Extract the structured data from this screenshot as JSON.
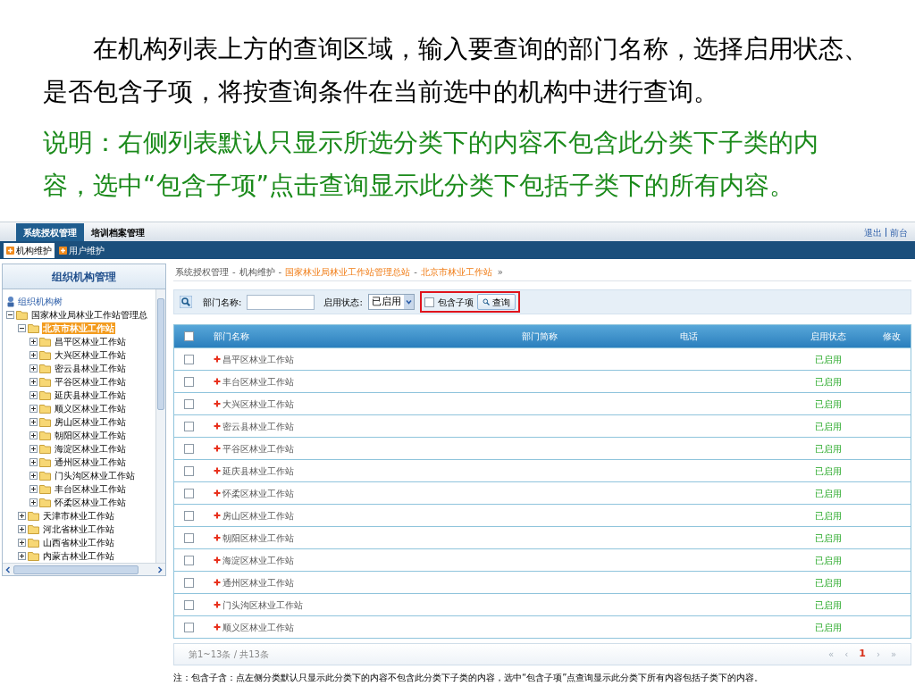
{
  "slide": {
    "paragraph": "在机构列表上方的查询区域，输入要查询的部门名称，选择启用状态、是否包含子项，将按查询条件在当前选中的机构中进行查询。",
    "note": "说明：右侧列表默认只显示所选分类下的内容不包含此分类下子类的内容，选中“包含子项”点击查询显示此分类下包括子类下的所有内容。"
  },
  "top_tabs": [
    {
      "label": "系统授权管理",
      "selected": true
    },
    {
      "label": "培训档案管理",
      "selected": false
    }
  ],
  "top_links": [
    "退出",
    "前台"
  ],
  "sub_tabs": [
    {
      "label": "机构维护",
      "selected": true
    },
    {
      "label": "用户维护",
      "selected": false
    }
  ],
  "sidebar": {
    "title": "组织机构管理",
    "tree": [
      {
        "label": "组织机构树",
        "kind": "root",
        "selected": false,
        "children": [
          {
            "label": "国家林业局林业工作站管理总",
            "kind": "folder",
            "selected": false,
            "expanded": true,
            "children": [
              {
                "label": "北京市林业工作站",
                "kind": "folder",
                "selected": true,
                "expanded": true,
                "children": [
                  {
                    "label": "昌平区林业工作站",
                    "kind": "folder",
                    "selected": false,
                    "expanded": false
                  },
                  {
                    "label": "大兴区林业工作站",
                    "kind": "folder",
                    "selected": false,
                    "expanded": false
                  },
                  {
                    "label": "密云县林业工作站",
                    "kind": "folder",
                    "selected": false,
                    "expanded": false
                  },
                  {
                    "label": "平谷区林业工作站",
                    "kind": "folder",
                    "selected": false,
                    "expanded": false
                  },
                  {
                    "label": "延庆县林业工作站",
                    "kind": "folder",
                    "selected": false,
                    "expanded": false
                  },
                  {
                    "label": "顺义区林业工作站",
                    "kind": "folder",
                    "selected": false,
                    "expanded": false
                  },
                  {
                    "label": "房山区林业工作站",
                    "kind": "folder",
                    "selected": false,
                    "expanded": false
                  },
                  {
                    "label": "朝阳区林业工作站",
                    "kind": "folder",
                    "selected": false,
                    "expanded": false
                  },
                  {
                    "label": "海淀区林业工作站",
                    "kind": "folder",
                    "selected": false,
                    "expanded": false
                  },
                  {
                    "label": "通州区林业工作站",
                    "kind": "folder",
                    "selected": false,
                    "expanded": false
                  },
                  {
                    "label": "门头沟区林业工作站",
                    "kind": "folder",
                    "selected": false,
                    "expanded": false
                  },
                  {
                    "label": "丰台区林业工作站",
                    "kind": "folder",
                    "selected": false,
                    "expanded": false
                  },
                  {
                    "label": "怀柔区林业工作站",
                    "kind": "folder",
                    "selected": false,
                    "expanded": false
                  }
                ]
              },
              {
                "label": "天津市林业工作站",
                "kind": "folder",
                "selected": false,
                "expanded": false
              },
              {
                "label": "河北省林业工作站",
                "kind": "folder",
                "selected": false,
                "expanded": false
              },
              {
                "label": "山西省林业工作站",
                "kind": "folder",
                "selected": false,
                "expanded": false
              },
              {
                "label": "内蒙古林业工作站",
                "kind": "folder",
                "selected": false,
                "expanded": false
              }
            ]
          }
        ]
      }
    ]
  },
  "breadcrumb": {
    "separator": "-",
    "end": "»",
    "items": [
      {
        "label": "系统授权管理",
        "kind": "plain"
      },
      {
        "label": "机构维护",
        "kind": "plain"
      },
      {
        "label": "国家林业局林业工作站管理总站",
        "kind": "link"
      },
      {
        "label": "北京市林业工作站",
        "kind": "link"
      }
    ]
  },
  "filters": {
    "name_label": "部门名称:",
    "status_label": "启用状态:",
    "status_value": "已启用",
    "include_children": {
      "label": "包含子项",
      "checked": false
    },
    "search_button": "查询",
    "highlight_box": true
  },
  "table": {
    "columns": [
      "部门名称",
      "部门简称",
      "电话",
      "启用状态",
      "修改"
    ],
    "all_checked": false,
    "rows": [
      {
        "name": "昌平区林业工作站",
        "status": "已启用",
        "checked": false
      },
      {
        "name": "丰台区林业工作站",
        "status": "已启用",
        "checked": false
      },
      {
        "name": "大兴区林业工作站",
        "status": "已启用",
        "checked": false
      },
      {
        "name": "密云县林业工作站",
        "status": "已启用",
        "checked": false
      },
      {
        "name": "平谷区林业工作站",
        "status": "已启用",
        "checked": false
      },
      {
        "name": "延庆县林业工作站",
        "status": "已启用",
        "checked": false
      },
      {
        "name": "怀柔区林业工作站",
        "status": "已启用",
        "checked": false
      },
      {
        "name": "房山区林业工作站",
        "status": "已启用",
        "checked": false
      },
      {
        "name": "朝阳区林业工作站",
        "status": "已启用",
        "checked": false
      },
      {
        "name": "海淀区林业工作站",
        "status": "已启用",
        "checked": false
      },
      {
        "name": "通州区林业工作站",
        "status": "已启用",
        "checked": false
      },
      {
        "name": "门头沟区林业工作站",
        "status": "已启用",
        "checked": false
      },
      {
        "name": "顺义区林业工作站",
        "status": "已启用",
        "checked": false
      }
    ]
  },
  "pager": {
    "summary": "第1~13条 / 共13条",
    "buttons": [
      {
        "label": "«",
        "selected": false
      },
      {
        "label": "‹",
        "selected": false
      },
      {
        "label": "1",
        "selected": true
      },
      {
        "label": "›",
        "selected": false
      },
      {
        "label": "»",
        "selected": false
      }
    ]
  },
  "footnote": "注：包含子含：点左侧分类默认只显示此分类下的内容不包含此分类下子类的内容，选中“包含子项”点查询显示此分类下所有内容包括子类下的内容。"
}
